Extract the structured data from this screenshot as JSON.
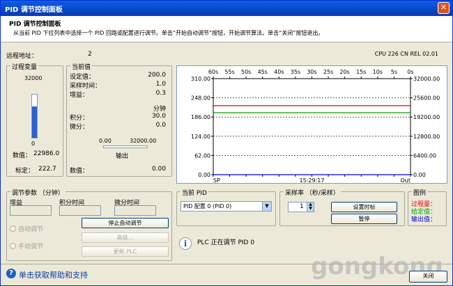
{
  "window": {
    "title": "PID 调节控制面板",
    "close_glyph": "✕"
  },
  "header": {
    "title": "PID 调节控制面板",
    "description": "从当前 PID 下拉列表中选择一个 PID 回路或配置进行调节。单击“开始自动调节”按钮，开始调节算法。单击“关闭”按钮退出。"
  },
  "top": {
    "remote_label": "远程地址：",
    "remote_value": "2",
    "cpu_info": "CPU 226 CN REL 02.01"
  },
  "process_variable": {
    "title": "过程变量",
    "scale_max": "32000",
    "scale_min": "0",
    "bar_fraction": 0.7183,
    "bar_color": "#2a5fd4",
    "value_label": "数值：",
    "value": "22986.0",
    "scaled_label": "标定：",
    "scaled": "222.7"
  },
  "current_values": {
    "title": "当前值",
    "setpoint_label": "设定值：",
    "setpoint": "200.0",
    "sample_time_label": "采样时间：",
    "sample_time": "1.0",
    "gain_label": "增益：",
    "gain": "0.3",
    "minutes_label": "分钟",
    "integral_label": "积分：",
    "integral": "30.0",
    "derivative_label": "微分：",
    "derivative": "0.0",
    "output_min": "0.00",
    "output_max": "32000.00",
    "output_label": "输出",
    "value_label": "数值：",
    "value": "0.00"
  },
  "tuning_params": {
    "title": "调节参数 （分钟）",
    "gain_label": "增益",
    "integral_label": "积分时间",
    "derivative_label": "微分时间",
    "auto_label": "自动调节",
    "manual_label": "手动调节",
    "stop_button": "停止自动调节",
    "advanced_button": "高级...",
    "update_button": "更新 PLC"
  },
  "current_pid": {
    "title": "当前 PID",
    "selected": "PID 配置 0 (PID 0)",
    "status_text": "PLC 正在调节 PID 0"
  },
  "sample_rate": {
    "title": "采样率 （秒/采样）",
    "value": "1",
    "set_time_button": "设置时标",
    "pause_button": "暂停"
  },
  "legend": {
    "title": "图例",
    "items": [
      {
        "label": "过程量：",
        "color": "#e00000"
      },
      {
        "label": "给定值：",
        "color": "#00a000"
      },
      {
        "label": "输出值：",
        "color": "#0000e0"
      }
    ]
  },
  "footer": {
    "help_text": "单击获取帮助和支持",
    "close_button": "关闭",
    "watermark": "gongkong"
  },
  "chart_data": {
    "type": "line",
    "time_ticks": [
      "60s",
      "55s",
      "50s",
      "45s",
      "40s",
      "35s",
      "30s",
      "25s",
      "20s",
      "15s",
      "10s",
      "5s",
      "0s"
    ],
    "left_ticks": [
      "310.00",
      "248.00",
      "186.00",
      "124.00",
      "62.00",
      "0.00"
    ],
    "right_ticks": [
      "32000.00",
      "25600.00",
      "19200.00",
      "12800.00",
      "6400.00",
      "0.00"
    ],
    "left_range": [
      0,
      310
    ],
    "right_range": [
      0,
      32000
    ],
    "x_left_label": "SP",
    "x_center_label": "15:29:17",
    "x_right_label": "Out",
    "grid": true,
    "series": [
      {
        "name": "过程量",
        "color": "#e00000",
        "axis": "left",
        "values": [
          222.7,
          222.7
        ]
      },
      {
        "name": "给定值",
        "color": "#00a000",
        "axis": "left",
        "values": [
          200.0,
          200.0
        ]
      },
      {
        "name": "输出值",
        "color": "#0000e0",
        "axis": "right",
        "values": [
          0,
          0
        ]
      }
    ]
  }
}
